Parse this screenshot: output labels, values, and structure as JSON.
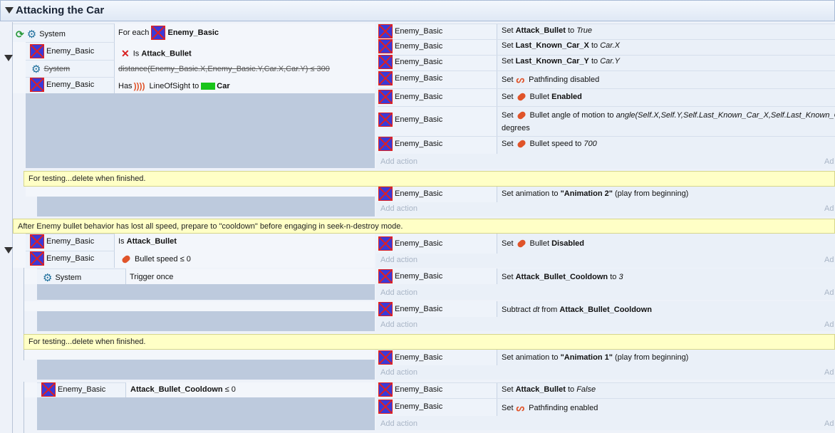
{
  "group": {
    "title": "Attacking the Car"
  },
  "objects": {
    "enemy": "Enemy_Basic",
    "system": "System"
  },
  "comments": {
    "c1": "For testing...delete when finished.",
    "c2": "After Enemy bullet behavior has lost all speed, prepare to \"cooldown\" before engaging in seek-n-destroy mode.",
    "c3": "For testing...delete when finished."
  },
  "e1": {
    "conditions": {
      "for_each": "For each",
      "for_each_obj": "Enemy_Basic",
      "is": "Is",
      "is_var": "Attack_Bullet",
      "distance": "distance(Enemy_Basic.X,Enemy_Basic.Y,Car.X,Car.Y) ≤ 300",
      "has": "Has",
      "los": "LineOfSight to",
      "car": "Car"
    },
    "actions": {
      "a1_set": "Set",
      "a1_var": "Attack_Bullet",
      "a1_to": "to",
      "a1_val": "True",
      "a2_set": "Set",
      "a2_var": "Last_Known_Car_X",
      "a2_to": "to",
      "a2_val": "Car.X",
      "a3_set": "Set",
      "a3_var": "Last_Known_Car_Y",
      "a3_to": "to",
      "a3_val": "Car.Y",
      "a4_set": "Set",
      "a4_txt": "Pathfinding disabled",
      "a5_set": "Set",
      "a5_txt": "Bullet",
      "a5_val": "Enabled",
      "a6_set": "Set",
      "a6_txt": "Bullet angle of motion to",
      "a6_val": "angle(Self.X,Self.Y,Self.Last_Known_Car_X,Self.Last_Known_Car_Y)",
      "a6_unit": "degrees",
      "a7_set": "Set",
      "a7_txt": "Bullet speed to",
      "a7_val": "700"
    }
  },
  "e2": {
    "action": "Set animation to",
    "anim": "\"Animation 2\"",
    "suffix": "(play from beginning)"
  },
  "e3": {
    "cond_is": "Is",
    "cond_var": "Attack_Bullet",
    "cond_speed": "Bullet speed ≤ 0",
    "a_set": "Set",
    "a_txt": "Bullet",
    "a_val": "Disabled"
  },
  "e4": {
    "cond": "Trigger once",
    "a_txt": "Set",
    "a_var": "Attack_Bullet_Cooldown",
    "a_to": "to",
    "a_val": "3"
  },
  "e5": {
    "a_txt": "Subtract",
    "a_dt": "dt",
    "a_from": "from",
    "a_var": "Attack_Bullet_Cooldown"
  },
  "e6": {
    "action": "Set animation to",
    "anim": "\"Animation 1\"",
    "suffix": "(play from beginning)"
  },
  "e7": {
    "cond_var": "Attack_Bullet_Cooldown",
    "cond_op": "≤ 0",
    "a1_set": "Set",
    "a1_var": "Attack_Bullet",
    "a1_to": "to",
    "a1_val": "False",
    "a2_set": "Set",
    "a2_txt": "Pathfinding enabled"
  },
  "ui": {
    "add_action": "Add action",
    "add_clip": "Ad"
  }
}
